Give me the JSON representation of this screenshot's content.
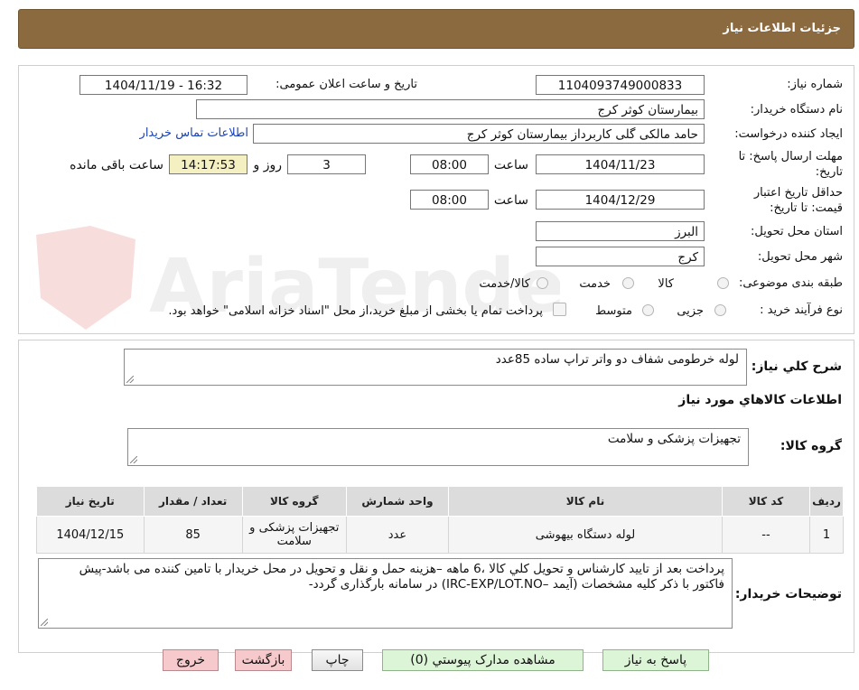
{
  "header": {
    "title": "جزئیات اطلاعات نیاز"
  },
  "form": {
    "need_number_label": "شماره نیاز:",
    "need_number": "1104093749000833",
    "announce_label": "تاریخ و ساعت اعلان عمومی:",
    "announce_value": "1404/11/19 - 16:32",
    "buyer_name_label": "نام دستگاه خریدار:",
    "buyer_name": "بیمارستان کوثر کرج",
    "creator_label": "ایجاد کننده درخواست:",
    "creator": "حامد مالکی گلی کاربرداز بیمارستان کوثر کرج",
    "contact_link": "اطلاعات تماس خریدار",
    "deadline_label_line1": "مهلت ارسال پاسخ: تا",
    "deadline_label_line2": "تاریخ:",
    "deadline_date": "1404/11/23",
    "time_label": "ساعت",
    "deadline_time": "08:00",
    "days_value": "3",
    "days_label": "روز و",
    "remaining_time": "14:17:53",
    "remaining_label": "ساعت باقی مانده",
    "validity_label_line1": "حداقل تاریخ اعتبار",
    "validity_label_line2": "قیمت: تا تاریخ:",
    "validity_date": "1404/12/29",
    "validity_time": "08:00",
    "province_label": "استان محل تحویل:",
    "province": "البرز",
    "city_label": "شهر محل تحویل:",
    "city": "کرج",
    "category_label": "طبقه بندی موضوعی:",
    "category_options": [
      "کالا",
      "خدمت",
      "کالا/خدمت"
    ],
    "process_label": "نوع فرآیند خرید :",
    "process_options": [
      "جزیی",
      "متوسط"
    ],
    "treasury_note": "پرداخت تمام یا بخشی از مبلغ خرید،از محل \"اسناد خزانه اسلامی\" خواهد بود."
  },
  "summary": {
    "label": "شرح کلي نياز:",
    "value": "لوله خرطومی شفاف دو واتر تراپ ساده   85عدد",
    "items_title": "اطلاعات کالاهاي مورد نياز",
    "group_label": "گروه کالا:",
    "group_value": "تجهیزات پزشکی و سلامت"
  },
  "table": {
    "headers": [
      "رديف",
      "کد کالا",
      "نام کالا",
      "واحد شمارش",
      "گروه کالا",
      "تعداد / مقدار",
      "تاريخ نياز"
    ],
    "rows": [
      [
        "1",
        "--",
        "لوله دستگاه بیهوشی",
        "عدد",
        "تجهیزات پزشکی و سلامت",
        "85",
        "1404/12/15"
      ]
    ]
  },
  "notes": {
    "label": "توضيحات خريدار:",
    "value": "پرداخت بعد از تایید کارشناس و تحویل کلي کالا ،6 ماهه –هزینه حمل و نقل و تحویل در محل خریدار با تامین کننده می باشد-پیش فاکتور با ذکر کلیه مشخصات (آیمد –IRC-EXP/LOT.NO) در سامانه بارگذاری گردد-"
  },
  "buttons": {
    "reply": "پاسخ به نياز",
    "attachments": "مشاهده مدارک پيوستي (0)",
    "print": "چاپ",
    "back": "بازگشت",
    "exit": "خروج"
  },
  "watermark": {
    "text": "AriaTender.neT"
  },
  "colors": {
    "header": "#8c6a3f",
    "link": "#1a44b8",
    "highlight": "#f5f0c2"
  }
}
